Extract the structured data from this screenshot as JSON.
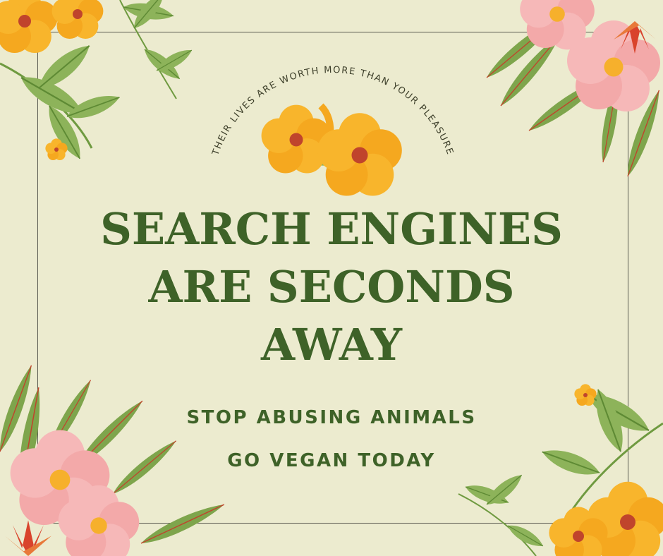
{
  "arc_text": "THEIR LIVES ARE WORTH MORE THAN YOUR PLEASURE",
  "headline": {
    "line1": "SEARCH ENGINES",
    "line2": "ARE SECONDS",
    "line3": "AWAY"
  },
  "subline": {
    "line1": "STOP ABUSING ANIMALS",
    "line2": "GO VEGAN TODAY"
  },
  "colors": {
    "background": "#ecebcf",
    "text_green": "#3e6228",
    "leaf": "#8db35a",
    "leaf_dark": "#6f9a40",
    "petal_pink": "#f6b8b8",
    "petal_yellow": "#f8b52c",
    "petal_red": "#d9432c"
  },
  "icons": [
    "leaf-icon",
    "pink-flower-icon",
    "yellow-flower-icon",
    "red-flower-icon"
  ]
}
